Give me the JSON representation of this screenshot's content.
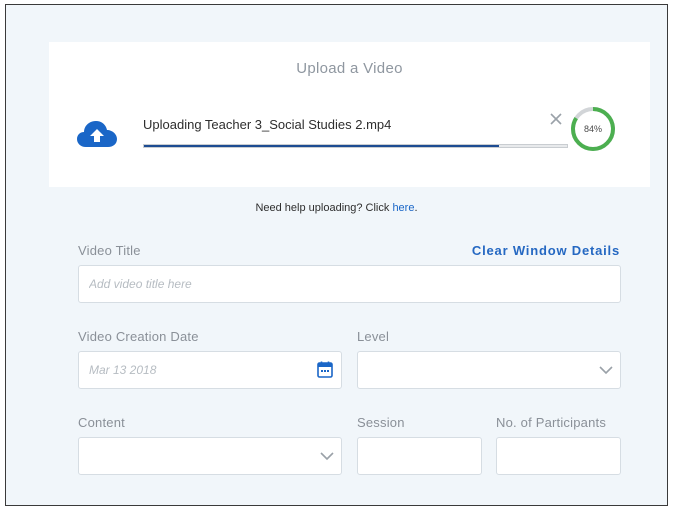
{
  "upload": {
    "heading": "Upload a Video",
    "file_label": "Uploading Teacher 3_Social Studies 2.mp4",
    "progress": 0.84,
    "progress_label": "84%"
  },
  "help": {
    "prefix": "Need help uploading? Click ",
    "link": "here",
    "suffix": "."
  },
  "form": {
    "clear_label": "Clear Window Details",
    "video_title": {
      "label": "Video Title",
      "placeholder": "Add video title here",
      "value": ""
    },
    "creation_date": {
      "label": "Video Creation Date",
      "placeholder": "Mar 13 2018",
      "value": ""
    },
    "level": {
      "label": "Level",
      "value": ""
    },
    "content": {
      "label": "Content",
      "value": ""
    },
    "session": {
      "label": "Session",
      "value": ""
    },
    "participants": {
      "label": "No. of Participants",
      "value": ""
    }
  },
  "colors": {
    "accent": "#1a66c7",
    "progress_bar": "#1d4c92",
    "progress_ring": "#4caf50",
    "background": "#f1f6fa"
  },
  "icons": {
    "upload": "cloud-upload-icon",
    "cancel": "close-icon",
    "calendar": "calendar-icon",
    "dropdown": "chevron-down-icon"
  }
}
